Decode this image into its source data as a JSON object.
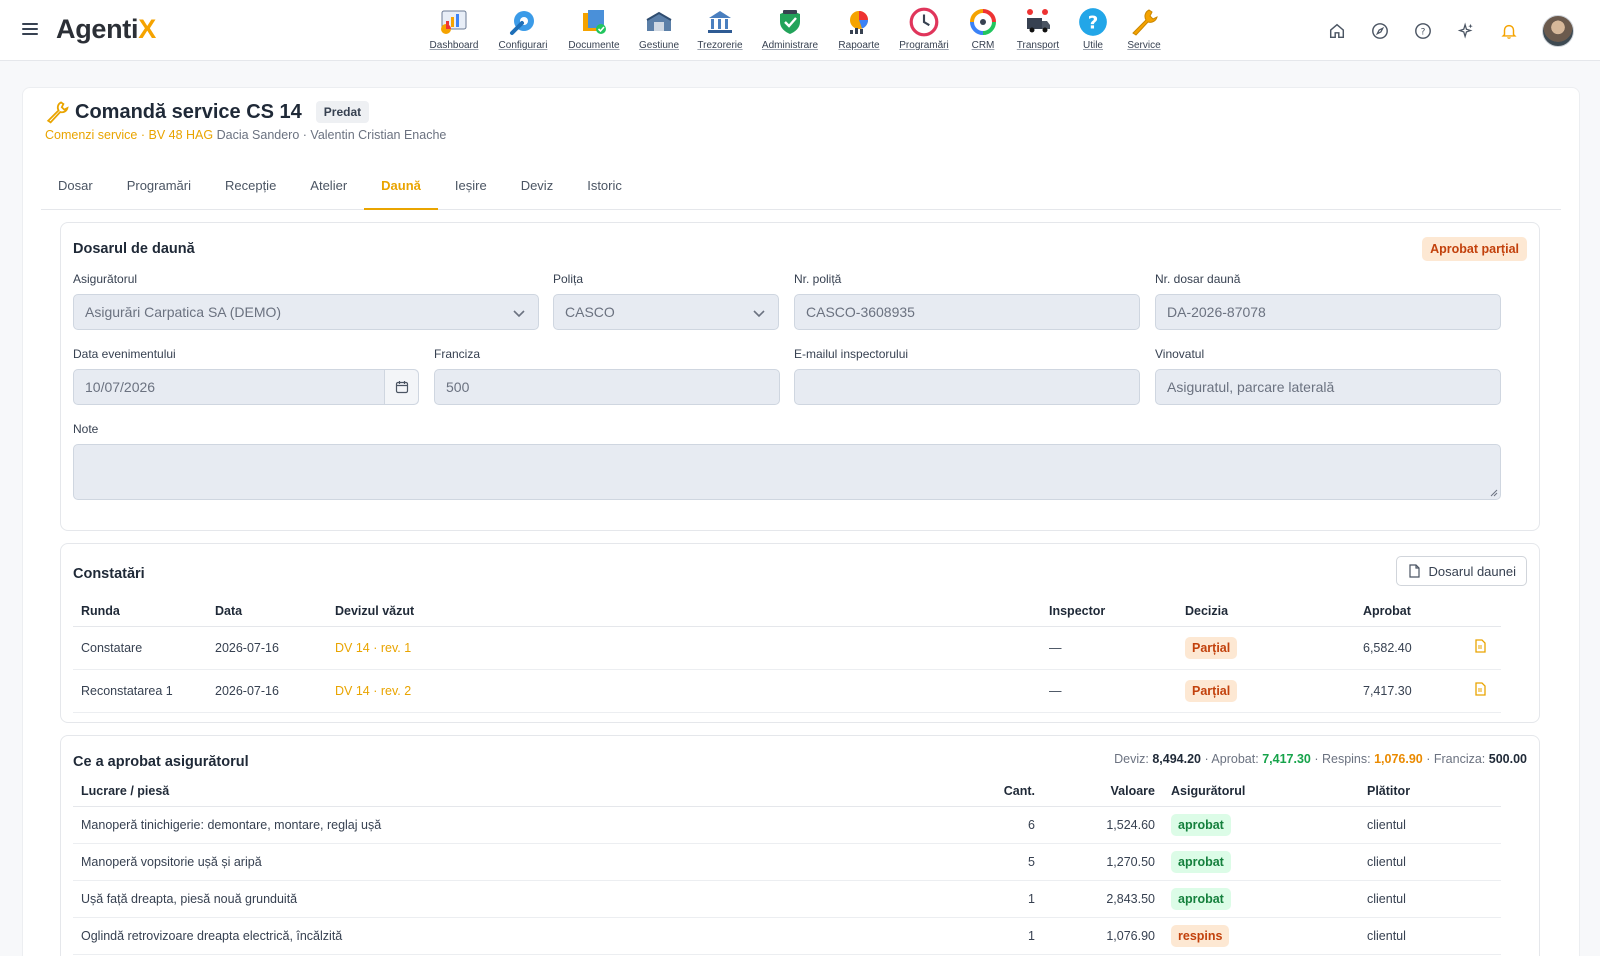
{
  "app": {
    "logo_main": "Agenti",
    "logo_accent": "X"
  },
  "modules": [
    {
      "label": "Dashboard",
      "icon": "dashboard-icon"
    },
    {
      "label": "Configurari",
      "icon": "configurari-icon"
    },
    {
      "label": "Documente",
      "icon": "documente-icon"
    },
    {
      "label": "Gestiune",
      "icon": "gestiune-icon"
    },
    {
      "label": "Trezorerie",
      "icon": "trezorerie-icon"
    },
    {
      "label": "Administrare",
      "icon": "administrare-icon"
    },
    {
      "label": "Rapoarte",
      "icon": "rapoarte-icon"
    },
    {
      "label": "Programări",
      "icon": "programari-icon"
    },
    {
      "label": "CRM",
      "icon": "crm-icon"
    },
    {
      "label": "Transport",
      "icon": "transport-icon"
    },
    {
      "label": "Utile",
      "icon": "utile-icon"
    },
    {
      "label": "Service",
      "icon": "service-icon"
    }
  ],
  "page": {
    "title": "Comandă service CS 14",
    "status": "Predat",
    "breadcrumb_link": "Comenzi service",
    "breadcrumb_sep1": " · ",
    "plate": "BV 48 HAG",
    "vehicle": " Dacia Sandero",
    "breadcrumb_sep2": " · ",
    "client": "Valentin Cristian Enache"
  },
  "tabs": [
    "Dosar",
    "Programări",
    "Recepție",
    "Atelier",
    "Daună",
    "Ieșire",
    "Deviz",
    "Istoric"
  ],
  "active_tab": "Daună",
  "claim": {
    "title": "Dosarul de daună",
    "status": "Aprobat parțial",
    "insurer_label": "Asigurătorul",
    "insurer_value": "Asigurări Carpatica SA (DEMO)",
    "policy_label": "Polița",
    "policy_value": "CASCO",
    "policy_no_label": "Nr. poliță",
    "policy_no_value": "CASCO-3608935",
    "claim_no_label": "Nr. dosar daună",
    "claim_no_value": "DA-2026-87078",
    "event_date_label": "Data evenimentului",
    "event_date_value": "10/07/2026",
    "deductible_label": "Franciza",
    "deductible_value": "500",
    "inspector_email_label": "E-mailul inspectorului",
    "inspector_email_value": "",
    "guilty_label": "Vinovatul",
    "guilty_value": "Asiguratul, parcare laterală",
    "notes_label": "Note",
    "notes_value": ""
  },
  "findings": {
    "title": "Constatări",
    "button": "Dosarul daunei",
    "headers": [
      "Runda",
      "Data",
      "Devizul văzut",
      "Inspector",
      "Decizia",
      "Aprobat"
    ],
    "rows": [
      {
        "round": "Constatare",
        "date": "2026-07-16",
        "estimate": "DV 14 · rev. 1",
        "inspector": "—",
        "decision": "Parțial",
        "approved": "6,582.40"
      },
      {
        "round": "Reconstatarea 1",
        "date": "2026-07-16",
        "estimate": "DV 14 · rev. 2",
        "inspector": "—",
        "decision": "Parțial",
        "approved": "7,417.30"
      }
    ]
  },
  "approved": {
    "title": "Ce a aprobat asigurătorul",
    "summary": {
      "deviz_label": "Deviz:",
      "deviz_value": "8,494.20",
      "approved_label": " · Aprobat:",
      "approved_value": "7,417.30",
      "rejected_label": " · Respins:",
      "rejected_value": "1,076.90",
      "deductible_label": " · Franciza:",
      "deductible_value": "500.00"
    },
    "headers": [
      "Lucrare / piesă",
      "Cant.",
      "Valoare",
      "Asigurătorul",
      "Plătitor"
    ],
    "rows": [
      {
        "item": "Manoperă tinichigerie: demontare, montare, reglaj ușă",
        "qty": "6",
        "value": "1,524.60",
        "insurer": "aprobat",
        "payer": "clientul"
      },
      {
        "item": "Manoperă vopsitorie ușă și aripă",
        "qty": "5",
        "value": "1,270.50",
        "insurer": "aprobat",
        "payer": "clientul"
      },
      {
        "item": "Ușă față dreapta, piesă nouă grunduită",
        "qty": "1",
        "value": "2,843.50",
        "insurer": "aprobat",
        "payer": "clientul"
      },
      {
        "item": "Oglindă retrovizoare dreapta electrică, încălzită",
        "qty": "1",
        "value": "1,076.90",
        "insurer": "respins",
        "payer": "clientul"
      }
    ]
  },
  "colors": {
    "accent": "#e9a400",
    "approved_green": "#16a34a",
    "rejected_orange": "#ea8a00"
  }
}
